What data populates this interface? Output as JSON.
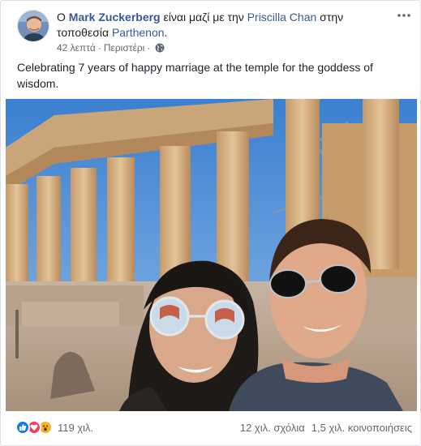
{
  "post": {
    "prefix": "Ο",
    "author": "Mark Zuckerberg",
    "middle_text": "είναι μαζί με την",
    "tagged": "Priscilla Chan",
    "location_prefix": "στην τοποθεσία",
    "location": "Parthenon",
    "location_suffix": ".",
    "timestamp": "42 λεπτά",
    "separator": "·",
    "place": "Περιστέρι",
    "privacy_icon": "globe-icon",
    "caption": "Celebrating 7 years of happy marriage at the temple for the goddess of wisdom."
  },
  "footer": {
    "reaction_icons": [
      "like-icon",
      "love-icon",
      "wow-icon"
    ],
    "reaction_count": "119 χιλ.",
    "comments": "12 χιλ. σχόλια",
    "shares": "1,5 χιλ. κοινοποιήσεις"
  },
  "colors": {
    "link": "#385898",
    "meta": "#616770",
    "like": "#1877f2",
    "love": "#f33e58",
    "wow": "#f7b125"
  }
}
